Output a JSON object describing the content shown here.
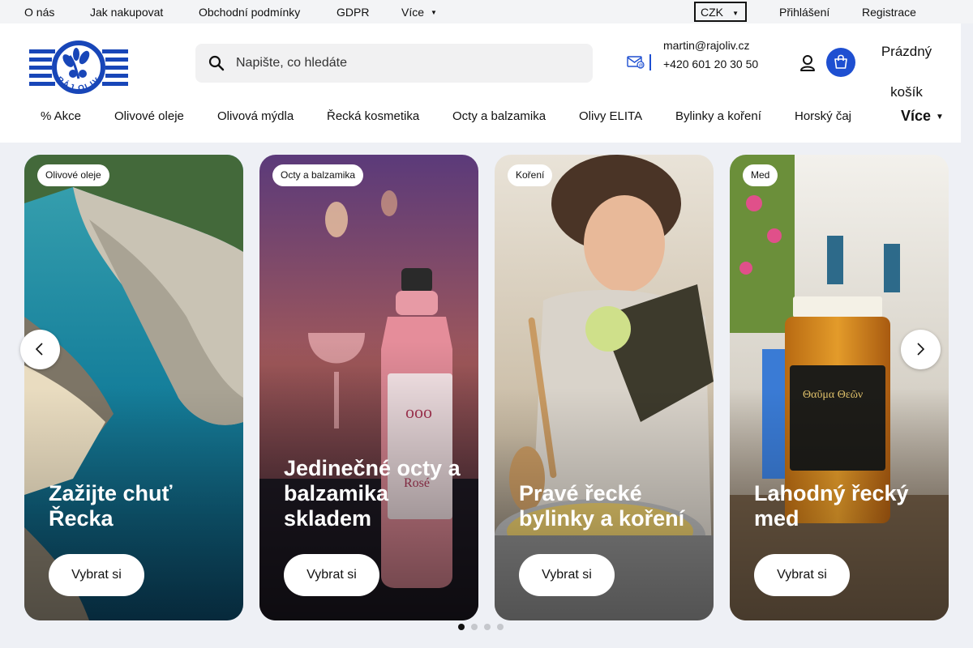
{
  "topbar": {
    "links": [
      "O nás",
      "Jak nakupovat",
      "Obchodní podmínky",
      "GDPR",
      "Více"
    ],
    "currency": "CZK",
    "login": "Přihlášení",
    "register": "Registrace"
  },
  "header": {
    "logo_text": "RÁJ OLIV",
    "search_placeholder": "Napište, co hledáte",
    "email": "martin@rajoliv.cz",
    "phone": "+420 601 20 30 50",
    "cart_label": "Prázdný košík"
  },
  "nav": {
    "items": [
      "% Akce",
      "Olivové oleje",
      "Olivová mýdla",
      "Řecká kosmetika",
      "Octy a balzamika",
      "Olivy ELITA",
      "Bylinky a koření",
      "Horský čaj"
    ],
    "more": "Více"
  },
  "slides": [
    {
      "tag": "Olivové oleje",
      "headline": "Zažijte chuť Řecka",
      "cta": "Vybrat si"
    },
    {
      "tag": "Octy a balzamika",
      "headline": "Jedinečné octy a balzamika skladem",
      "cta": "Vybrat si"
    },
    {
      "tag": "Koření",
      "headline": "Pravé řecké bylinky a koření",
      "cta": "Vybrat si"
    },
    {
      "tag": "Med",
      "headline": "Lahodný řecký med",
      "cta": "Vybrat si"
    }
  ],
  "carousel": {
    "current_page": 1,
    "total_pages": 4
  },
  "colors": {
    "brand_blue": "#1e4fd1",
    "logo_blue": "#1846b8"
  },
  "icons": [
    "search-icon",
    "mail-icon",
    "user-icon",
    "cart-icon",
    "chevron-left-icon",
    "chevron-right-icon"
  ]
}
